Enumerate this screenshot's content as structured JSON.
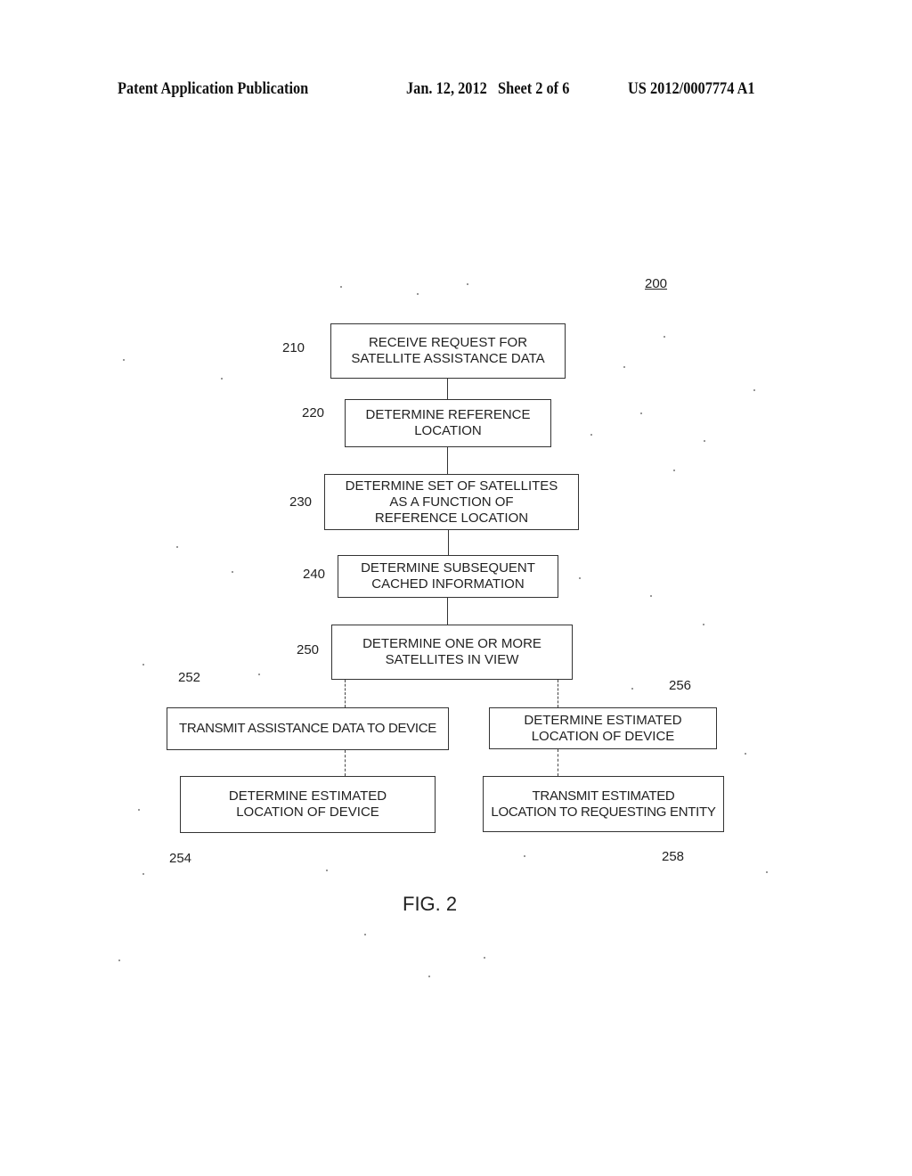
{
  "header": {
    "publication": "Patent Application Publication",
    "date_sheet": "Jan. 12, 2012   Sheet 2 of 6",
    "patent_number": "US 2012/0007774 A1"
  },
  "figure": {
    "number": "200",
    "caption": "FIG. 2"
  },
  "flowchart": {
    "steps": [
      {
        "ref": "210",
        "text": "RECEIVE REQUEST FOR\nSATELLITE ASSISTANCE DATA"
      },
      {
        "ref": "220",
        "text": "DETERMINE REFERENCE\nLOCATION"
      },
      {
        "ref": "230",
        "text": "DETERMINE SET OF SATELLITES\nAS A FUNCTION OF\nREFERENCE LOCATION"
      },
      {
        "ref": "240",
        "text": "DETERMINE SUBSEQUENT\nCACHED INFORMATION"
      },
      {
        "ref": "250",
        "text": "DETERMINE ONE OR MORE\nSATELLITES IN VIEW"
      }
    ],
    "left_branch": [
      {
        "ref": "252",
        "text": "TRANSMIT ASSISTANCE DATA TO DEVICE"
      },
      {
        "ref": "254",
        "text": "DETERMINE ESTIMATED\nLOCATION OF DEVICE"
      }
    ],
    "right_branch": [
      {
        "ref": "256",
        "text": "DETERMINE ESTIMATED\nLOCATION OF DEVICE"
      },
      {
        "ref": "258",
        "text": "TRANSMIT ESTIMATED\nLOCATION TO REQUESTING ENTITY"
      }
    ]
  }
}
